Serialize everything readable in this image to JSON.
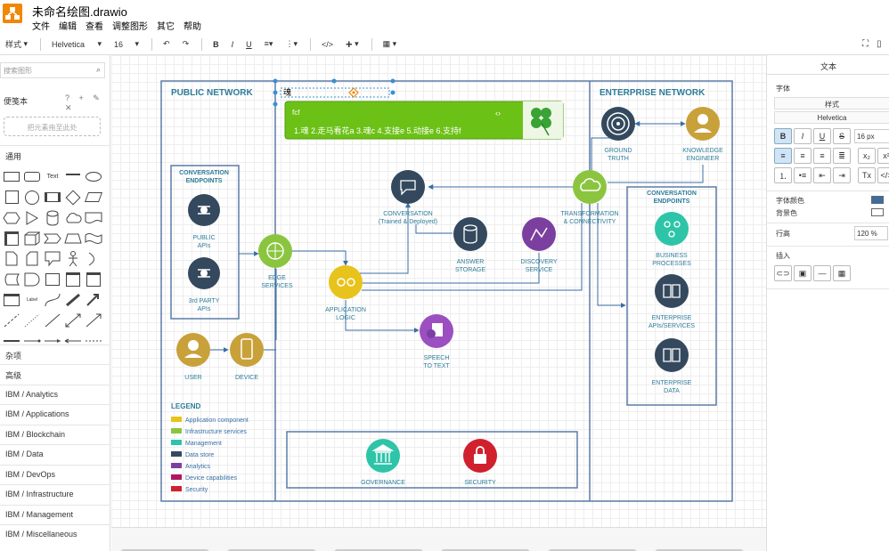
{
  "app": {
    "title": "未命名绘图.drawio",
    "menu": [
      "文件",
      "编辑",
      "查看",
      "调整图形",
      "其它",
      "帮助"
    ]
  },
  "toolbar": {
    "style_label": "样式",
    "font_family": "Helvetica",
    "font_size": "16",
    "bold": "B",
    "italic": "I",
    "underline": "U",
    "html": "</>",
    "insert": "+"
  },
  "left_panel": {
    "search_placeholder": "搜索图形",
    "scratchpad_title": "便笺本",
    "scratchpad_tools": "? + ✎ ✕",
    "drop_hint": "把元素拖至此处",
    "sections": [
      "通用",
      "杂项",
      "高级",
      "IBM / Analytics",
      "IBM / Applications",
      "IBM / Blockchain",
      "IBM / Data",
      "IBM / DevOps",
      "IBM / Infrastructure",
      "IBM / Management",
      "IBM / Miscellaneous"
    ]
  },
  "right_panel": {
    "tab": "文本",
    "font_label": "字体",
    "style_value": "样式",
    "font_value": "Helvetica",
    "size_value": "16 px",
    "font_color_label": "字体颜色",
    "bg_color_label": "背景色",
    "line_height_label": "行高",
    "line_height_value": "120 %",
    "insert_label": "插入"
  },
  "diagram": {
    "public_network": "PUBLIC NETWORK",
    "enterprise_network": "ENTERPRISE NETWORK",
    "selected_text": "魂",
    "ticker_title": "fcf",
    "ticker_text": "1.魂 2.走马看花a 3.魂c 4.支接e 5.动接e 6.支持f",
    "conv_endpoints_left": [
      "CONVERSATION",
      "ENDPOINTS"
    ],
    "conv_endpoints_right": [
      "CONVERSATION",
      "ENDPOINTS"
    ],
    "public_apis": [
      "PUBLIC",
      "APIs"
    ],
    "third_party_apis": [
      "3rd PARTY",
      "APIs"
    ],
    "edge_services": [
      "EDGE",
      "SERVICES"
    ],
    "user": "USER",
    "device": "DEVICE",
    "conversation": [
      "CONVERSATION",
      "(Trained & Deployed)"
    ],
    "answer_storage": [
      "ANSWER",
      "STORAGE"
    ],
    "discovery_service": [
      "DISCOVERY",
      "SERVICE"
    ],
    "application_logic": [
      "APPLICATION",
      "LOGIC"
    ],
    "speech_to_text": [
      "SPEECH",
      "TO TEXT"
    ],
    "transformation": [
      "TRANSFORMATION",
      "& CONNECTIVITY"
    ],
    "ground_truth": [
      "GROUND",
      "TRUTH"
    ],
    "knowledge_engineer": [
      "KNOWLEDGE",
      "ENGINEER"
    ],
    "business_processes": [
      "BUSINESS",
      "PROCESSES"
    ],
    "enterprise_apis": [
      "ENTERPRISE",
      "APIs/SERVICES"
    ],
    "enterprise_data": [
      "ENTERPRISE",
      "DATA"
    ],
    "governance": "GOVERNANCE",
    "security": "SECURITY",
    "legend_title": "LEGEND",
    "legend": [
      {
        "label": "Application component",
        "color": "#e8c31b"
      },
      {
        "label": "Infrastructure services",
        "color": "#8bc53f"
      },
      {
        "label": "Management",
        "color": "#2ec4a8"
      },
      {
        "label": "Data store",
        "color": "#34495e"
      },
      {
        "label": "Analytics",
        "color": "#7b3fa0"
      },
      {
        "label": "Device capabilities",
        "color": "#b0185f"
      },
      {
        "label": "Security",
        "color": "#d0202e"
      }
    ],
    "colors": {
      "frame": "#5b7ba8",
      "title_blue": "#1f4e8c",
      "teal": "#2d7c9a"
    }
  }
}
